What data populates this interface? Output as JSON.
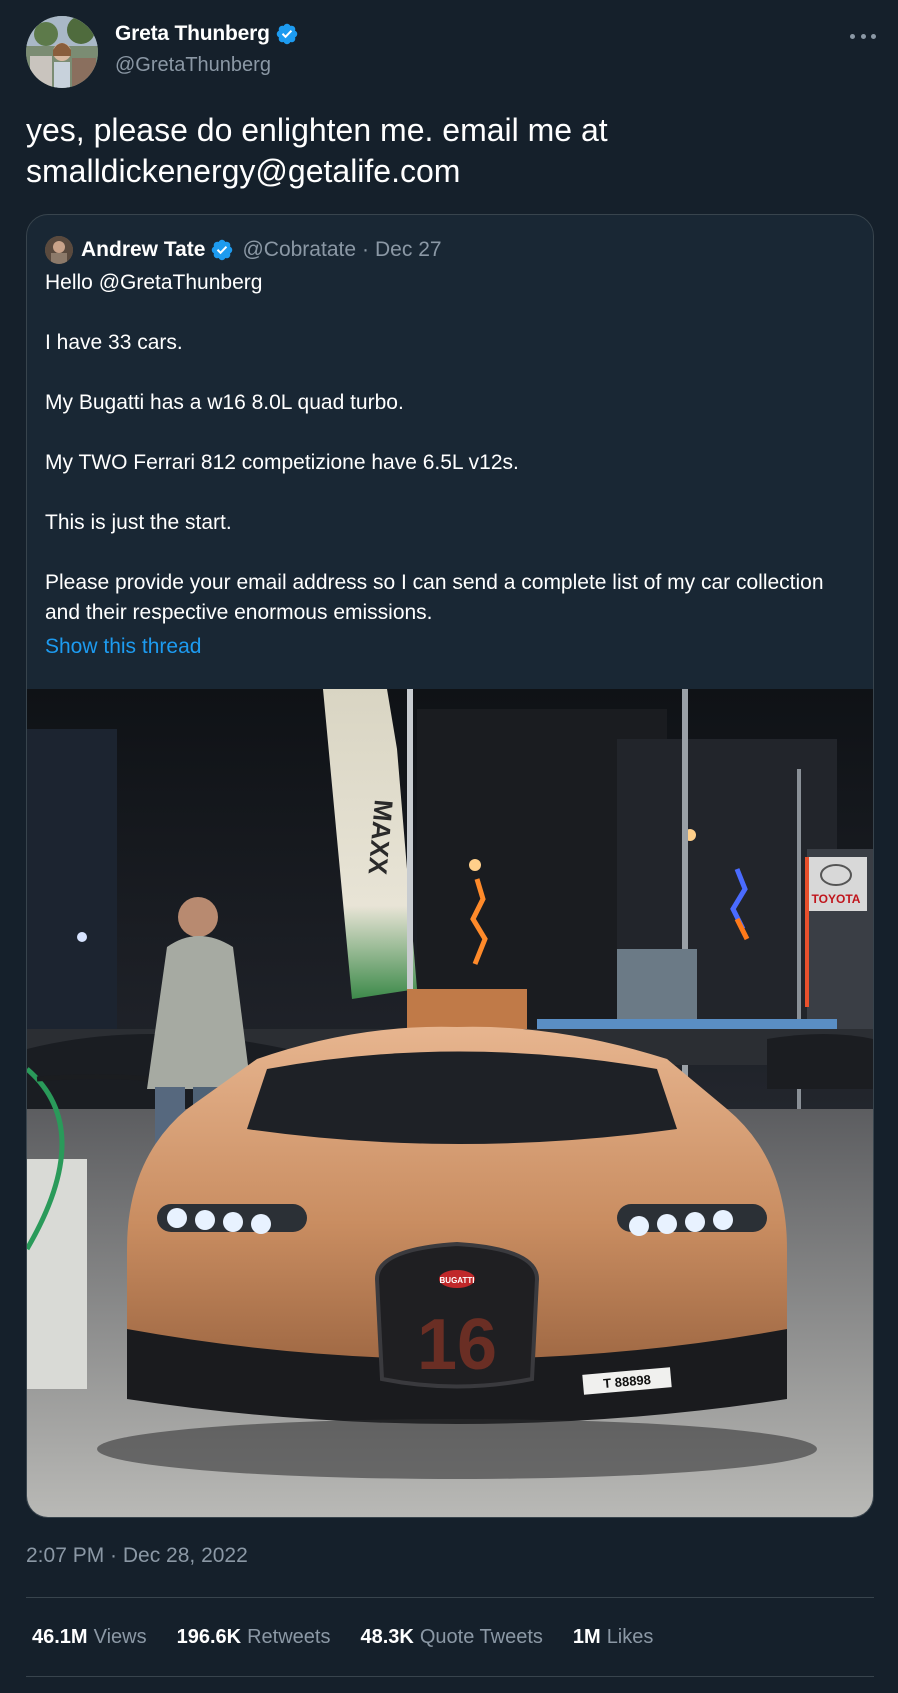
{
  "author": {
    "name": "Greta Thunberg",
    "handle": "@GretaThunberg",
    "verified_color": "#1d9bf0"
  },
  "tweet": {
    "text_line1": "yes, please do enlighten me. email me at",
    "text_line2": "smalldickenergy@getalife.com",
    "timestamp": "2:07 PM · Dec 28, 2022"
  },
  "quoted": {
    "name": "Andrew Tate",
    "handle": "@Cobratate",
    "separator": "·",
    "date": "Dec 27",
    "paragraphs": [
      "Hello @GretaThunberg",
      "I have 33 cars.",
      "My Bugatti has a w16 8.0L quad turbo.",
      "My TWO Ferrari 812 competizione have 6.5L v12s.",
      "This is just the start.",
      "Please provide your email address so I can send a complete list of my car collection and their respective enormous emissions."
    ],
    "show_thread": "Show this thread",
    "photo_signs": {
      "flag": "MAXX",
      "dealer": "TOYOTA",
      "badge": "BUGATTI",
      "grille_number": "16",
      "plate": "T 88898"
    }
  },
  "stats": [
    {
      "value": "46.1M",
      "label": "Views"
    },
    {
      "value": "196.6K",
      "label": "Retweets"
    },
    {
      "value": "48.3K",
      "label": "Quote Tweets"
    },
    {
      "value": "1M",
      "label": "Likes"
    }
  ],
  "colors": {
    "background": "#15202b",
    "secondary_text": "#8b98a5",
    "link": "#1d9bf0",
    "border": "#38444d"
  }
}
